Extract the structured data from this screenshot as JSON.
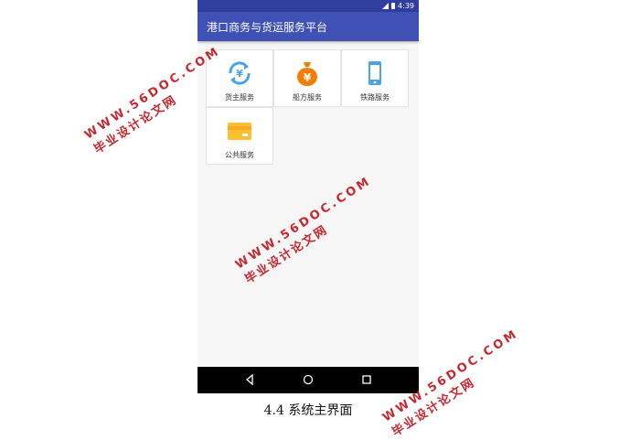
{
  "status_bar": {
    "time": "4:39"
  },
  "app_bar": {
    "title": "港口商务与货运服务平台"
  },
  "tiles": [
    {
      "label": "货主服务",
      "icon": "cargo-owner-exchange-icon"
    },
    {
      "label": "船方服务",
      "icon": "money-bag-icon"
    },
    {
      "label": "铁路服务",
      "icon": "mobile-phone-icon"
    },
    {
      "label": "公共服务",
      "icon": "card-icon"
    }
  ],
  "colors": {
    "primary": "#3f51b5",
    "primary_dark": "#303f9f",
    "blue_icon": "#4aa3e8",
    "orange_icon": "#f57c00",
    "yellow_icon": "#fbc02d",
    "watermark": "#c0111a"
  },
  "caption": "4.4 系统主界面",
  "watermark": {
    "url": "WWW.56DOC.COM",
    "text": "毕业设计论文网"
  }
}
